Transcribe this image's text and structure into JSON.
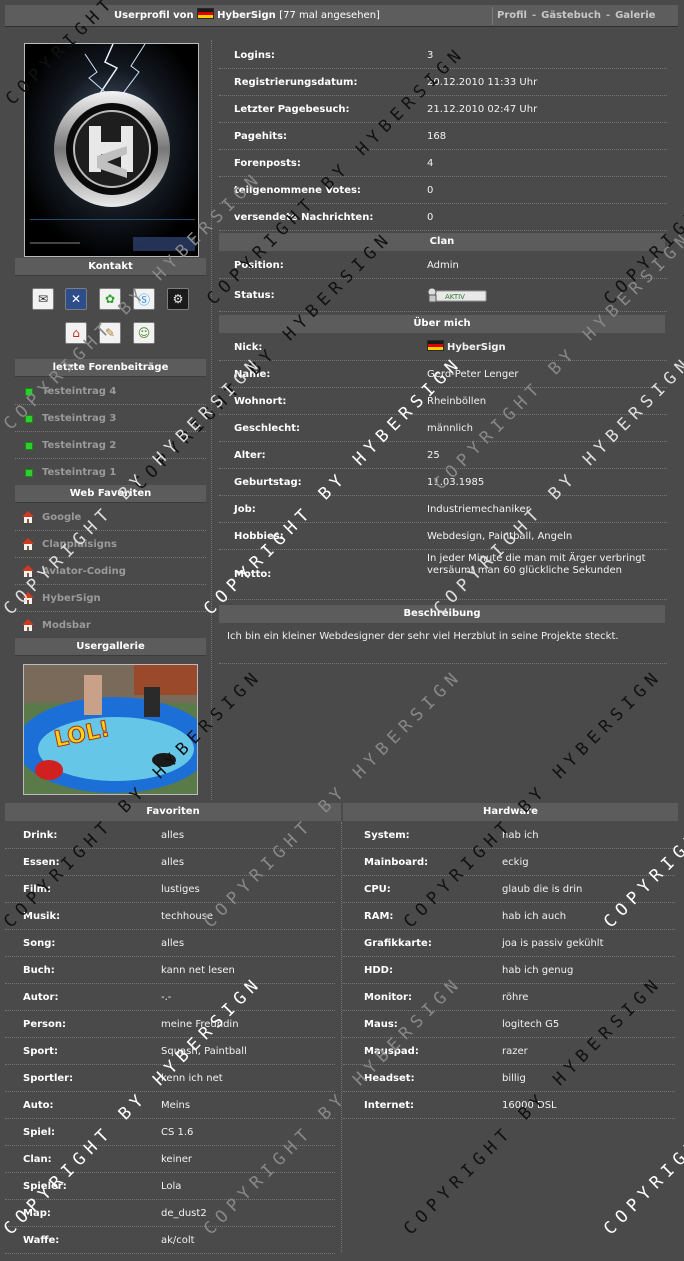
{
  "header": {
    "title_prefix": "Userprofil von",
    "username": "HyberSign",
    "views": "[77 mal angesehen]",
    "nav": [
      "Profil",
      "Gästebuch",
      "Galerie"
    ],
    "nav_separator": "-"
  },
  "sidebar": {
    "contact_title": "Kontakt",
    "contact_icons": [
      "mail-icon",
      "xfire-icon",
      "icq-icon",
      "skype-icon",
      "steam-icon",
      "homepage-icon",
      "guestbook-icon",
      "add-buddy-icon"
    ],
    "posts_title": "letzte Forenbeiträge",
    "posts": [
      "Testeintrag 4",
      "Testeintrag 3",
      "Testeintrag 2",
      "Testeintrag 1"
    ],
    "favorites_title": "Web Favoriten",
    "web_favorites": [
      "Google",
      "Clanplaisigns",
      "Aviator-Coding",
      "HyberSign",
      "Modsbar"
    ],
    "gallery_title": "Usergallerie",
    "gallery_caption": "LOL!"
  },
  "stats": [
    {
      "label": "Logins:",
      "value": "3"
    },
    {
      "label": "Registrierungsdatum:",
      "value": "20.12.2010 11:33 Uhr"
    },
    {
      "label": "Letzter Pagebesuch:",
      "value": "21.12.2010 02:47 Uhr"
    },
    {
      "label": "Pagehits:",
      "value": "168"
    },
    {
      "label": "Forenposts:",
      "value": "4"
    },
    {
      "label": "teilgenommene Votes:",
      "value": "0"
    },
    {
      "label": "versendete Nachrichten:",
      "value": "0"
    }
  ],
  "clan": {
    "title": "Clan",
    "position_label": "Position:",
    "position_value": "Admin",
    "status_label": "Status:",
    "status_badge": "AKTIV"
  },
  "about": {
    "title": "Über mich",
    "nick_label": "Nick:",
    "nick_value": "HyberSign",
    "rows": [
      {
        "label": "Name:",
        "value": "Gerd-Peter Lenger"
      },
      {
        "label": "Wohnort:",
        "value": "Rheinböllen"
      },
      {
        "label": "Geschlecht:",
        "value": "männlich"
      },
      {
        "label": "Alter:",
        "value": "25"
      },
      {
        "label": "Geburtstag:",
        "value": "11.03.1985"
      },
      {
        "label": "Job:",
        "value": "Industriemechaniker"
      },
      {
        "label": "Hobbies:",
        "value": "Webdesign, Paintball, Angeln"
      }
    ],
    "motto_label": "Motto:",
    "motto_value": "In jeder Minute die man mit Ärger verbringt versäumt man 60 glückliche Sekunden"
  },
  "description": {
    "title": "Beschreibung",
    "text": "Ich bin ein kleiner Webdesigner der sehr viel Herzblut in seine Projekte steckt."
  },
  "favorites": {
    "title": "Favoriten",
    "rows": [
      {
        "label": "Drink:",
        "value": "alles"
      },
      {
        "label": "Essen:",
        "value": "alles"
      },
      {
        "label": "Film:",
        "value": "lustiges"
      },
      {
        "label": "Musik:",
        "value": "techhouse"
      },
      {
        "label": "Song:",
        "value": "alles"
      },
      {
        "label": "Buch:",
        "value": "kann net lesen"
      },
      {
        "label": "Autor:",
        "value": "-.-"
      },
      {
        "label": "Person:",
        "value": "meine Freundin"
      },
      {
        "label": "Sport:",
        "value": "Squash, Paintball"
      },
      {
        "label": "Sportler:",
        "value": "kenn ich net"
      },
      {
        "label": "Auto:",
        "value": "Meins"
      },
      {
        "label": "Spiel:",
        "value": "CS 1.6"
      },
      {
        "label": "Clan:",
        "value": "keiner"
      },
      {
        "label": "Spieler:",
        "value": "Lola"
      },
      {
        "label": "Map:",
        "value": "de_dust2"
      },
      {
        "label": "Waffe:",
        "value": "ak/colt"
      }
    ]
  },
  "hardware": {
    "title": "Hardware",
    "rows": [
      {
        "label": "System:",
        "value": "hab ich"
      },
      {
        "label": "Mainboard:",
        "value": "eckig"
      },
      {
        "label": "CPU:",
        "value": "glaub die is drin"
      },
      {
        "label": "RAM:",
        "value": "hab ich auch"
      },
      {
        "label": "Grafikkarte:",
        "value": "joa is passiv gekühlt"
      },
      {
        "label": "HDD:",
        "value": "hab ich genug"
      },
      {
        "label": "Monitor:",
        "value": "röhre"
      },
      {
        "label": "Maus:",
        "value": "logitech G5"
      },
      {
        "label": "Mauspad:",
        "value": "razer"
      },
      {
        "label": "Headset:",
        "value": "billig"
      },
      {
        "label": "Internet:",
        "value": "16000 DSL"
      }
    ]
  },
  "watermark": "COPYRIGHT BY HYBERSIGN",
  "colors": {
    "flag_black": "#1a1a1a",
    "flag_red": "#dd0000",
    "flag_gold": "#ffce00",
    "post_bullet": "#2fce2f"
  }
}
